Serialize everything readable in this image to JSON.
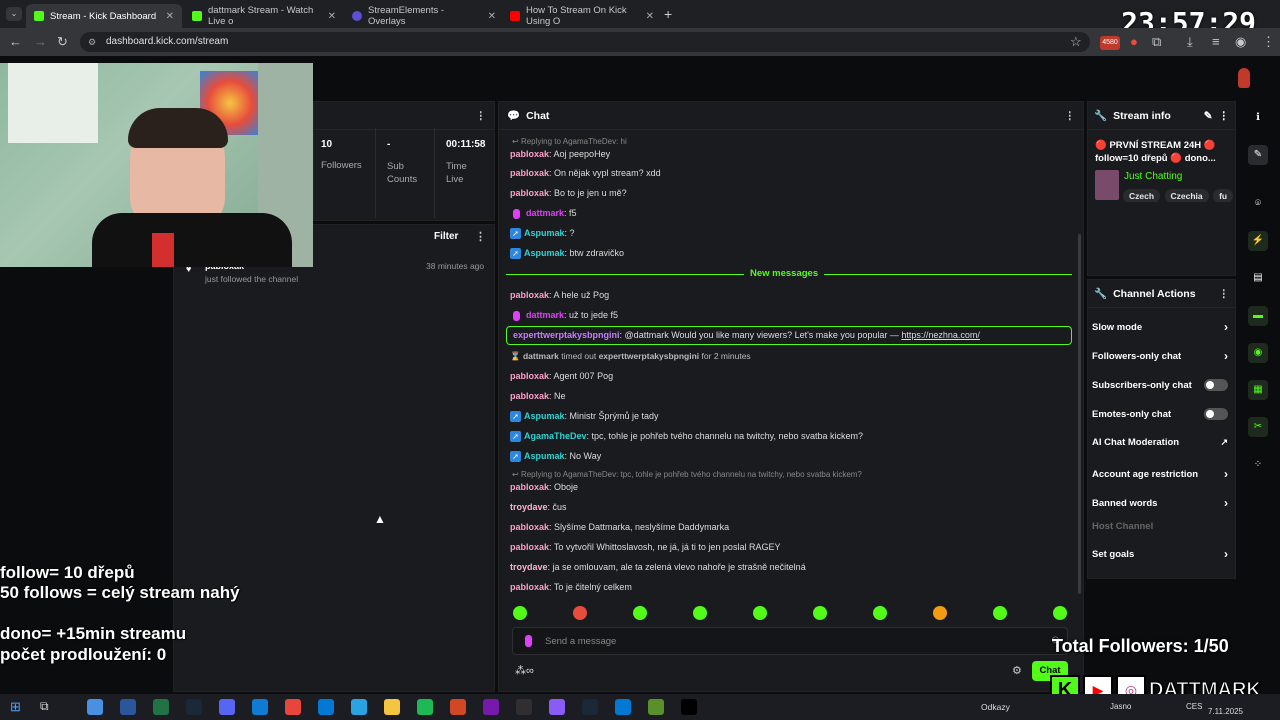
{
  "browser": {
    "tabs": [
      {
        "label": "Stream - Kick Dashboard",
        "active": true,
        "color": "#53fc18"
      },
      {
        "label": "dattmark Stream - Watch Live o",
        "active": false,
        "color": "#53fc18"
      },
      {
        "label": "StreamElements - Overlays",
        "active": false,
        "color": "#5b4fd6"
      },
      {
        "label": "How To Stream On Kick Using O",
        "active": false,
        "color": "#ff0000"
      }
    ],
    "url": "dashboard.kick.com/stream",
    "ext_badge": "4580"
  },
  "clock": "23:57:29",
  "stats": {
    "followers_value": "10",
    "followers_label": "Followers",
    "subs_value": "-",
    "subs_label": "Sub Counts",
    "time_value": "00:11:58",
    "time_label": "Time Live"
  },
  "activity": {
    "filter_label": "Filter",
    "item_user": "pabloxak",
    "item_action": "just followed the channel",
    "item_time": "38 minutes ago"
  },
  "chat": {
    "title": "Chat",
    "new_messages": "New messages",
    "input_placeholder": "Send a message",
    "send_label": "Chat",
    "messages": [
      {
        "reply": "Replying to AgamaTheDev: hi"
      },
      {
        "user": "pabloxak",
        "color": "#ff9ecb",
        "text": "Aoj peepoHey"
      },
      {
        "user": "pabloxak",
        "color": "#ff9ecb",
        "text": "On nějak vypl stream? xdd"
      },
      {
        "user": "pabloxak",
        "color": "#ff9ecb",
        "text": "Bo to je jen u mě?"
      },
      {
        "user": "dattmark",
        "color": "#e040fb",
        "text": "f5",
        "mic": true
      },
      {
        "user": "Aspumak",
        "color": "#2fd3d3",
        "text": "?",
        "badge": true
      },
      {
        "user": "Aspumak",
        "color": "#2fd3d3",
        "text": "btw zdravičko",
        "badge": true
      },
      {
        "divider": true
      },
      {
        "user": "pabloxak",
        "color": "#ff9ecb",
        "text": "A hele už Pog"
      },
      {
        "user": "dattmark",
        "color": "#e040fb",
        "text": "už to jede f5",
        "mic": true
      },
      {
        "user": "experttwerptakysbpngini",
        "color": "#c77dff",
        "text": "@dattmark Would you like many viewers? Let's make you popular —",
        "link": "https://nezhna.com/",
        "highlight": true
      },
      {
        "system": true,
        "user": "dattmark",
        "mid": " timed out ",
        "target": "experttwerptakysbpngini",
        "tail": " for 2 minutes"
      },
      {
        "user": "pabloxak",
        "color": "#ff9ecb",
        "text": "Agent 007 Pog"
      },
      {
        "user": "pabloxak",
        "color": "#ff9ecb",
        "text": "Ne"
      },
      {
        "user": "Aspumak",
        "color": "#2fd3d3",
        "text": "Ministr Šprýmů je tady",
        "badge": true
      },
      {
        "user": "AgamaTheDev",
        "color": "#2fd3d3",
        "text": "tpc, tohle je pohřeb tvého channelu na twitchy, nebo svatba kickem?",
        "badge": true
      },
      {
        "user": "Aspumak",
        "color": "#2fd3d3",
        "text": "No Way",
        "badge": true
      },
      {
        "reply": "Replying to AgamaTheDev: tpc, tohle je pohřeb tvého channelu na twitchy, nebo svatba kickem?"
      },
      {
        "user": "pabloxak",
        "color": "#ff9ecb",
        "text": "Oboje"
      },
      {
        "user": "troydave",
        "color": "#ffb3d1",
        "text": "čus"
      },
      {
        "user": "pabloxak",
        "color": "#ff9ecb",
        "text": "Slyšíme Dattmarka, neslyšíme Daddymarka"
      },
      {
        "user": "pabloxak",
        "color": "#ff9ecb",
        "text": "To vytvořil Whittoslavosh, ne já, já ti to jen poslal RAGEY"
      },
      {
        "user": "troydave",
        "color": "#ffb3d1",
        "text": "ja se omlouvam, ale ta zelená vlevo nahoře je strašně nečitelná"
      },
      {
        "user": "pabloxak",
        "color": "#ff9ecb",
        "text": "To je čitelný celkem"
      }
    ]
  },
  "stream_info": {
    "title": "Stream info",
    "stream_title": "🔴 PRVNÍ STREAM 24H 🔴 follow=10 dřepů 🔴 dono...",
    "category": "Just Chatting",
    "tags": [
      "Czech",
      "Czechia",
      "fu"
    ]
  },
  "channel_actions": {
    "title": "Channel Actions",
    "items": [
      {
        "label": "Slow mode",
        "kind": "chevron"
      },
      {
        "label": "Followers-only chat",
        "kind": "chevron"
      },
      {
        "label": "Subscribers-only chat",
        "kind": "toggle"
      },
      {
        "label": "Emotes-only chat",
        "kind": "toggle"
      },
      {
        "label": "AI Chat Moderation",
        "kind": "external"
      },
      {
        "label": "Account age restriction",
        "kind": "chevron"
      },
      {
        "label": "Banned words",
        "kind": "chevron"
      },
      {
        "label": "Host Channel",
        "kind": "disabled"
      },
      {
        "label": "Set goals",
        "kind": "chevron"
      }
    ]
  },
  "overlay": {
    "line1": "follow= 10 dřepů",
    "line2": "50 follows = celý stream nahý",
    "line3": "dono= +15min streamu",
    "line4": "počet prodloužení: 0",
    "total_followers": "Total Followers: 1/50",
    "brand": "DATTMARK"
  },
  "taskbar": {
    "links_label": "Odkazy",
    "weather": "Jasno",
    "lang": "CES",
    "date": "7.11.2025"
  }
}
